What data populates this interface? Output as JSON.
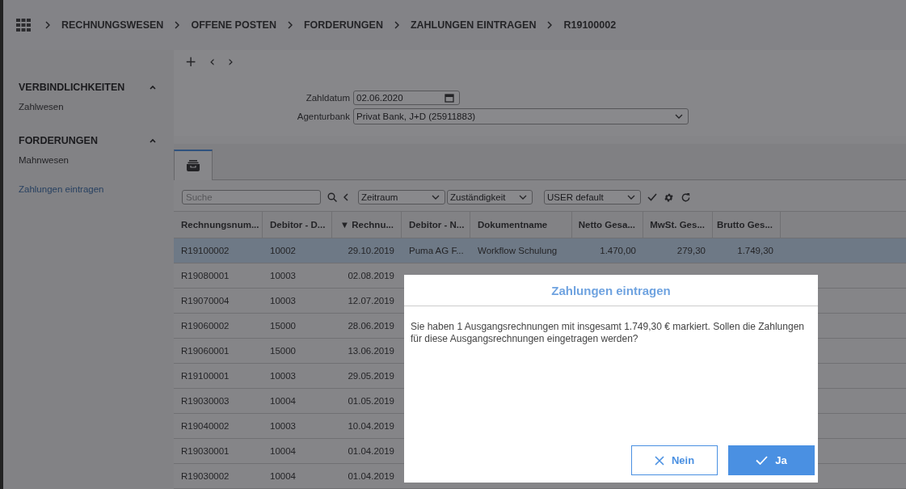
{
  "breadcrumb": [
    "RECHNUNGSWESEN",
    "OFFENE POSTEN",
    "FORDERUNGEN",
    "ZAHLUNGEN EINTRAGEN",
    "R19100002"
  ],
  "toolbar": {
    "add": "+",
    "prev": "‹",
    "next": "›"
  },
  "sidebar": {
    "sections": [
      {
        "title": "VERBINDLICHKEITEN",
        "expanded": true,
        "items": [
          {
            "label": "Zahlwesen",
            "selected": false
          }
        ]
      },
      {
        "title": "FORDERUNGEN",
        "expanded": true,
        "items": [
          {
            "label": "Mahnwesen",
            "selected": false
          },
          {
            "label": "Zahlungen eintragen",
            "selected": true
          }
        ]
      }
    ]
  },
  "form": {
    "fields": [
      {
        "label": "Zahldatum",
        "value": "02.06.2020",
        "kind": "date"
      },
      {
        "label": "Agenturbank",
        "value": "Privat Bank, J+D (25911883)",
        "kind": "select"
      }
    ]
  },
  "filters": {
    "search_placeholder": "Suche",
    "dropdowns": [
      "Zeitraum",
      "Zuständigkeit",
      "USER default"
    ]
  },
  "table": {
    "columns": [
      "Rechnungsnum...",
      "Debitor - D...",
      "▼ Rechnu...",
      "Debitor - N...",
      "Dokumentname",
      "Netto Gesa...",
      "MwSt. Ges...",
      "Brutto Ges..."
    ],
    "rows": [
      {
        "selected": true,
        "cells": [
          "R19100002",
          "10002",
          "29.10.2019",
          "Puma AG F...",
          "Workflow Schulung",
          "1.470,00",
          "279,30",
          "1.749,30"
        ]
      },
      {
        "selected": false,
        "cells": [
          "R19080001",
          "10003",
          "02.08.2019"
        ]
      },
      {
        "selected": false,
        "cells": [
          "R19070004",
          "10003",
          "12.07.2019"
        ]
      },
      {
        "selected": false,
        "cells": [
          "R19060002",
          "15000",
          "28.06.2019"
        ]
      },
      {
        "selected": false,
        "cells": [
          "R19060001",
          "15000",
          "13.06.2019"
        ]
      },
      {
        "selected": false,
        "cells": [
          "R19100001",
          "10003",
          "29.05.2019"
        ]
      },
      {
        "selected": false,
        "cells": [
          "R19030003",
          "10004",
          "01.05.2019"
        ]
      },
      {
        "selected": false,
        "cells": [
          "R19040002",
          "10003",
          "10.04.2019"
        ]
      },
      {
        "selected": false,
        "cells": [
          "R19030001",
          "10004",
          "01.04.2019"
        ]
      },
      {
        "selected": false,
        "cells": [
          "R19030002",
          "10004",
          "01.04.2019"
        ]
      }
    ]
  },
  "dialog": {
    "title": "Zahlungen eintragen",
    "message": "Sie haben 1 Ausgangsrechnungen mit insgesamt 1.749,30 € markiert. Sollen die Zahlungen für diese Ausgangsrechnungen eingetragen werden?",
    "buttons": [
      {
        "label": "Nein",
        "kind": "cancel"
      },
      {
        "label": "Ja",
        "kind": "confirm"
      }
    ]
  }
}
